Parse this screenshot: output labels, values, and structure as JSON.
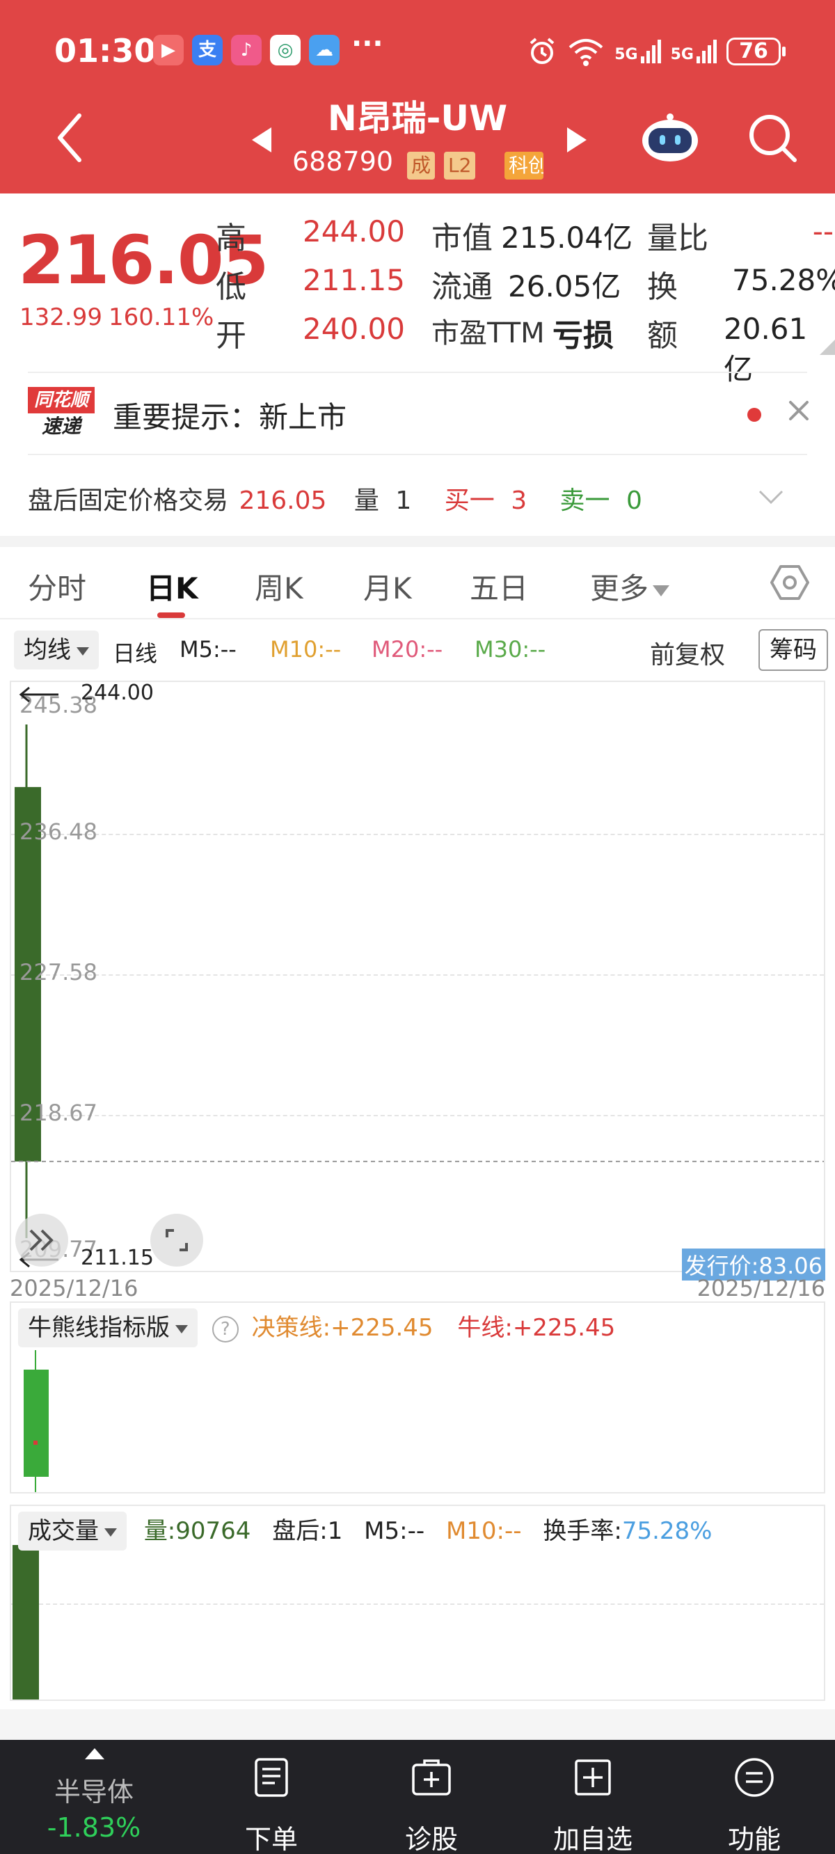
{
  "status_bar": {
    "time": "01:30",
    "battery": "76",
    "network_1": "5G",
    "network_2": "5G",
    "apps": [
      "video-app-icon",
      "alipay-icon",
      "music-app-icon",
      "mobile-app-icon",
      "weather-app-icon"
    ],
    "more": "···"
  },
  "header": {
    "name": "N昂瑞-UW",
    "code": "688790",
    "badges": {
      "cheng": "成",
      "l2": "L2",
      "kc": "科创"
    }
  },
  "quote": {
    "price": "216.05",
    "change": "132.99",
    "change_pct": "160.11%",
    "high_label": "高",
    "high": "244.00",
    "low_label": "低",
    "low": "211.15",
    "open_label": "开",
    "open": "240.00",
    "mcap_label": "市值",
    "mcap": "215.04亿",
    "float_label": "流通",
    "float": "26.05亿",
    "pe_label": "市盈TTM",
    "pe": "亏损",
    "vr_label": "量比",
    "vr": "--",
    "turnover_label": "换",
    "turnover": "75.28%",
    "amount_label": "额",
    "amount": "20.61亿"
  },
  "notice": {
    "logo_top": "同花顺",
    "logo_bottom": "速递",
    "text": "重要提示：新上市"
  },
  "after_hours": {
    "label": "盘后固定价格交易",
    "price": "216.05",
    "vol_label": "量",
    "vol": "1",
    "bid_label": "买一",
    "bid": "3",
    "ask_label": "卖一",
    "ask": "0"
  },
  "tabs": [
    {
      "label": "分时"
    },
    {
      "label": "日K"
    },
    {
      "label": "周K"
    },
    {
      "label": "月K"
    },
    {
      "label": "五日"
    },
    {
      "label": "更多"
    }
  ],
  "controls": {
    "ma_dropdown": "均线",
    "line_type": "日线",
    "m5": "M5:--",
    "m10": "M10:--",
    "m20": "M20:--",
    "m30": "M30:--",
    "adjust": "前复权",
    "chip": "筹码"
  },
  "kline": {
    "y_labels": [
      "245.38",
      "236.48",
      "227.58",
      "218.67",
      "209.77"
    ],
    "high_mark": "244.00",
    "low_mark": "211.15",
    "date_left": "2025/12/16",
    "date_right": "2025/12/16",
    "issue_price": "发行价:83.06"
  },
  "chart_data": {
    "type": "candlestick",
    "x": [
      "2025/12/16"
    ],
    "open": [
      240.0
    ],
    "high": [
      244.0
    ],
    "low": [
      211.15
    ],
    "close": [
      216.05
    ],
    "ylim": [
      209.77,
      245.38
    ],
    "volume": [
      90764
    ]
  },
  "indicator": {
    "name": "牛熊线指标版",
    "help": "?",
    "decision": "决策线:+225.45",
    "bull": "牛线:+225.45"
  },
  "volume": {
    "name": "成交量",
    "vol": "量:90764",
    "after": "盘后:1",
    "m5": "M5:--",
    "m10": "M10:--",
    "turnover_label": "换手率:",
    "turnover": "75.28%"
  },
  "bottom": {
    "sector": "半导体",
    "sector_chg": "-1.83%",
    "items": [
      {
        "label": "下单"
      },
      {
        "label": "诊股"
      },
      {
        "label": "加自选"
      },
      {
        "label": "功能"
      }
    ]
  },
  "colors": {
    "header": "#e04545",
    "up": "#d93a3a",
    "down": "#3a6a2a",
    "green_text": "#3a9a3a"
  }
}
